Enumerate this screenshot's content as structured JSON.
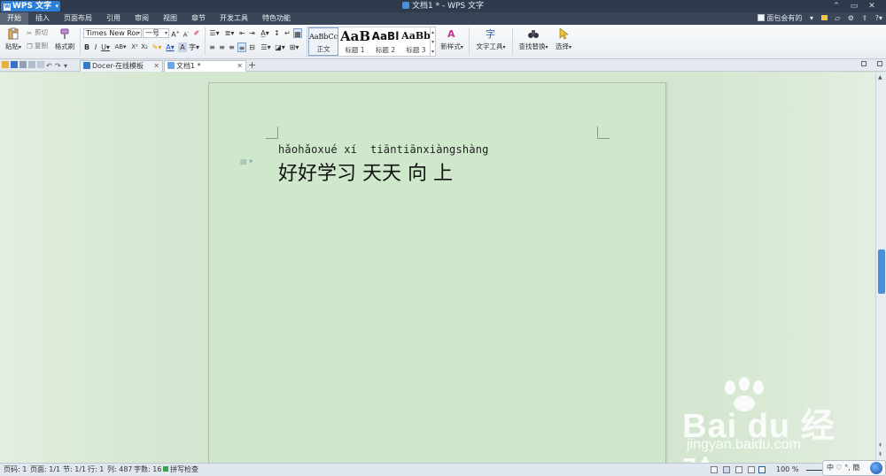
{
  "titlebar": {
    "app_name": "WPS 文字",
    "doc_title": "文档1 * - WPS 文字"
  },
  "menubar": {
    "tabs": [
      "开始",
      "插入",
      "页面布局",
      "引用",
      "审阅",
      "视图",
      "章节",
      "开发工具",
      "特色功能"
    ],
    "active_tab": "开始",
    "user_label": "面包会有的"
  },
  "ribbon": {
    "paste": "粘贴",
    "cut": "剪切",
    "copy": "复制",
    "format_painter": "格式刷",
    "font_name": "Times New Roı",
    "font_size": "一号",
    "styles": [
      {
        "preview": "AaBbCcDd",
        "label": "正文"
      },
      {
        "preview": "AaB",
        "label": "标题 1"
      },
      {
        "preview": "AaBl",
        "label": "标题 2"
      },
      {
        "preview": "AaBb",
        "label": "标题 3"
      }
    ],
    "new_style": "新样式",
    "text_tools": "文字工具",
    "find_replace": "查找替换",
    "select": "选择"
  },
  "doc_tabs": [
    {
      "label": "Docer-在线模板"
    },
    {
      "label": "文档1 *"
    }
  ],
  "document": {
    "pinyin_line": "hǎohǎoxué xí  tiāntiānxiàngshàng",
    "hanzi_line": "好好学习 天天 向 上"
  },
  "statusbar": {
    "page_code": "页码: 1",
    "page": "页面: 1/1",
    "section": "节: 1/1",
    "row": "行: 1",
    "col": "列: 487",
    "word_count": "字数: 16",
    "spell_check": "拼写检查",
    "zoom": "100 %"
  },
  "ime": {
    "label": "中 ♡ °, 簡"
  },
  "watermark": {
    "brand": "Bai du 经验",
    "url": "jingyan.baidu.com"
  }
}
